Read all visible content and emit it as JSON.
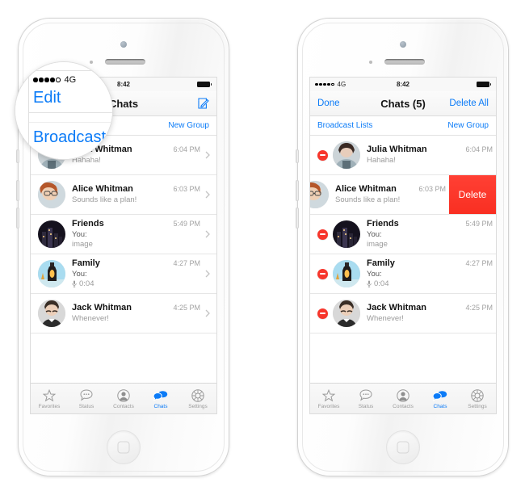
{
  "app": {
    "accent_blue": "#0b7bf7",
    "delete_red": "#f7362c",
    "muted_gray": "#9b9b9b"
  },
  "status_bar": {
    "carrier": "4G",
    "signal_dots_filled": 4,
    "signal_dots_total": 5,
    "time": "8:42"
  },
  "left_phone": {
    "nav": {
      "left_button": "Edit",
      "title": "Chats",
      "right_icon": "compose-icon"
    },
    "subbar": {
      "left": "Broadcast Lists",
      "right": "New Group"
    },
    "editing": false
  },
  "right_phone": {
    "nav": {
      "left_button": "Done",
      "title": "Chats (5)",
      "right_button": "Delete All"
    },
    "subbar": {
      "left": "Broadcast Lists",
      "right": "New Group"
    },
    "editing": true,
    "delete_button_label": "Delete",
    "swiped_row_index": 1
  },
  "chats": [
    {
      "name": "Julia Whitman",
      "time": "6:04 PM",
      "preview": "Hahaha!",
      "preview2": "",
      "has_mic": false,
      "avatar": "woman-dark-hair"
    },
    {
      "name": "Alice Whitman",
      "time": "6:03 PM",
      "preview": "Sounds like a plan!",
      "preview2": "",
      "has_mic": false,
      "avatar": "woman-glasses"
    },
    {
      "name": "Friends",
      "time": "5:49 PM",
      "preview": "You:",
      "preview2": "image",
      "has_mic": false,
      "avatar": "city-night"
    },
    {
      "name": "Family",
      "time": "4:27 PM",
      "preview": "You:",
      "preview2": "0:04",
      "has_mic": true,
      "avatar": "lantern"
    },
    {
      "name": "Jack Whitman",
      "time": "4:25 PM",
      "preview": "Whenever!",
      "preview2": "",
      "has_mic": false,
      "avatar": "man-mustache"
    }
  ],
  "tabs": [
    {
      "label": "Favorites",
      "icon": "star-icon",
      "active": false
    },
    {
      "label": "Status",
      "icon": "status-bubble-icon",
      "active": false
    },
    {
      "label": "Contacts",
      "icon": "person-icon",
      "active": false
    },
    {
      "label": "Chats",
      "icon": "chats-bubbles-icon",
      "active": true
    },
    {
      "label": "Settings",
      "icon": "gear-icon",
      "active": false
    }
  ],
  "magnifier": {
    "carrier": "4G",
    "edit_label": "Edit",
    "broadcast_label": "Broadcast"
  }
}
